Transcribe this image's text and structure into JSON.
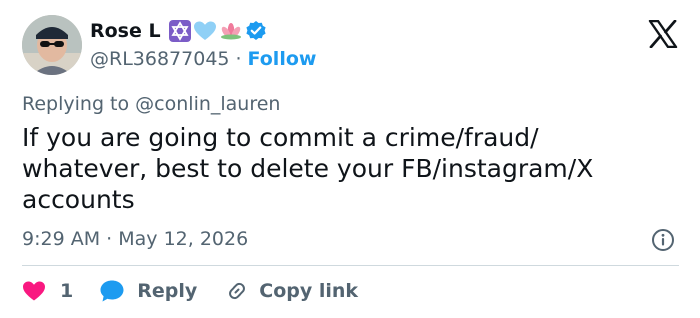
{
  "author": {
    "display_name": "Rose L",
    "handle": "@RL36877045",
    "separator": "·",
    "follow_label": "Follow",
    "name_emojis": [
      "star-of-david-icon",
      "light-blue-heart-icon",
      "lotus-icon"
    ],
    "verified": true
  },
  "reply_context": {
    "prefix": "Replying to",
    "mention": "@conlin_lauren"
  },
  "tweet": {
    "text": "If you are going to commit a crime/fraud/ whatever, best to delete your FB/instagram/X accounts",
    "time": "9:29 AM",
    "separator": "·",
    "date": "May 12, 2026"
  },
  "actions": {
    "like_count": "1",
    "reply_label": "Reply",
    "copy_link_label": "Copy link"
  },
  "colors": {
    "text": "#0f1419",
    "secondary": "#536471",
    "accent": "#1d9bf0",
    "like": "#f91880",
    "divider": "#cfd9de"
  }
}
